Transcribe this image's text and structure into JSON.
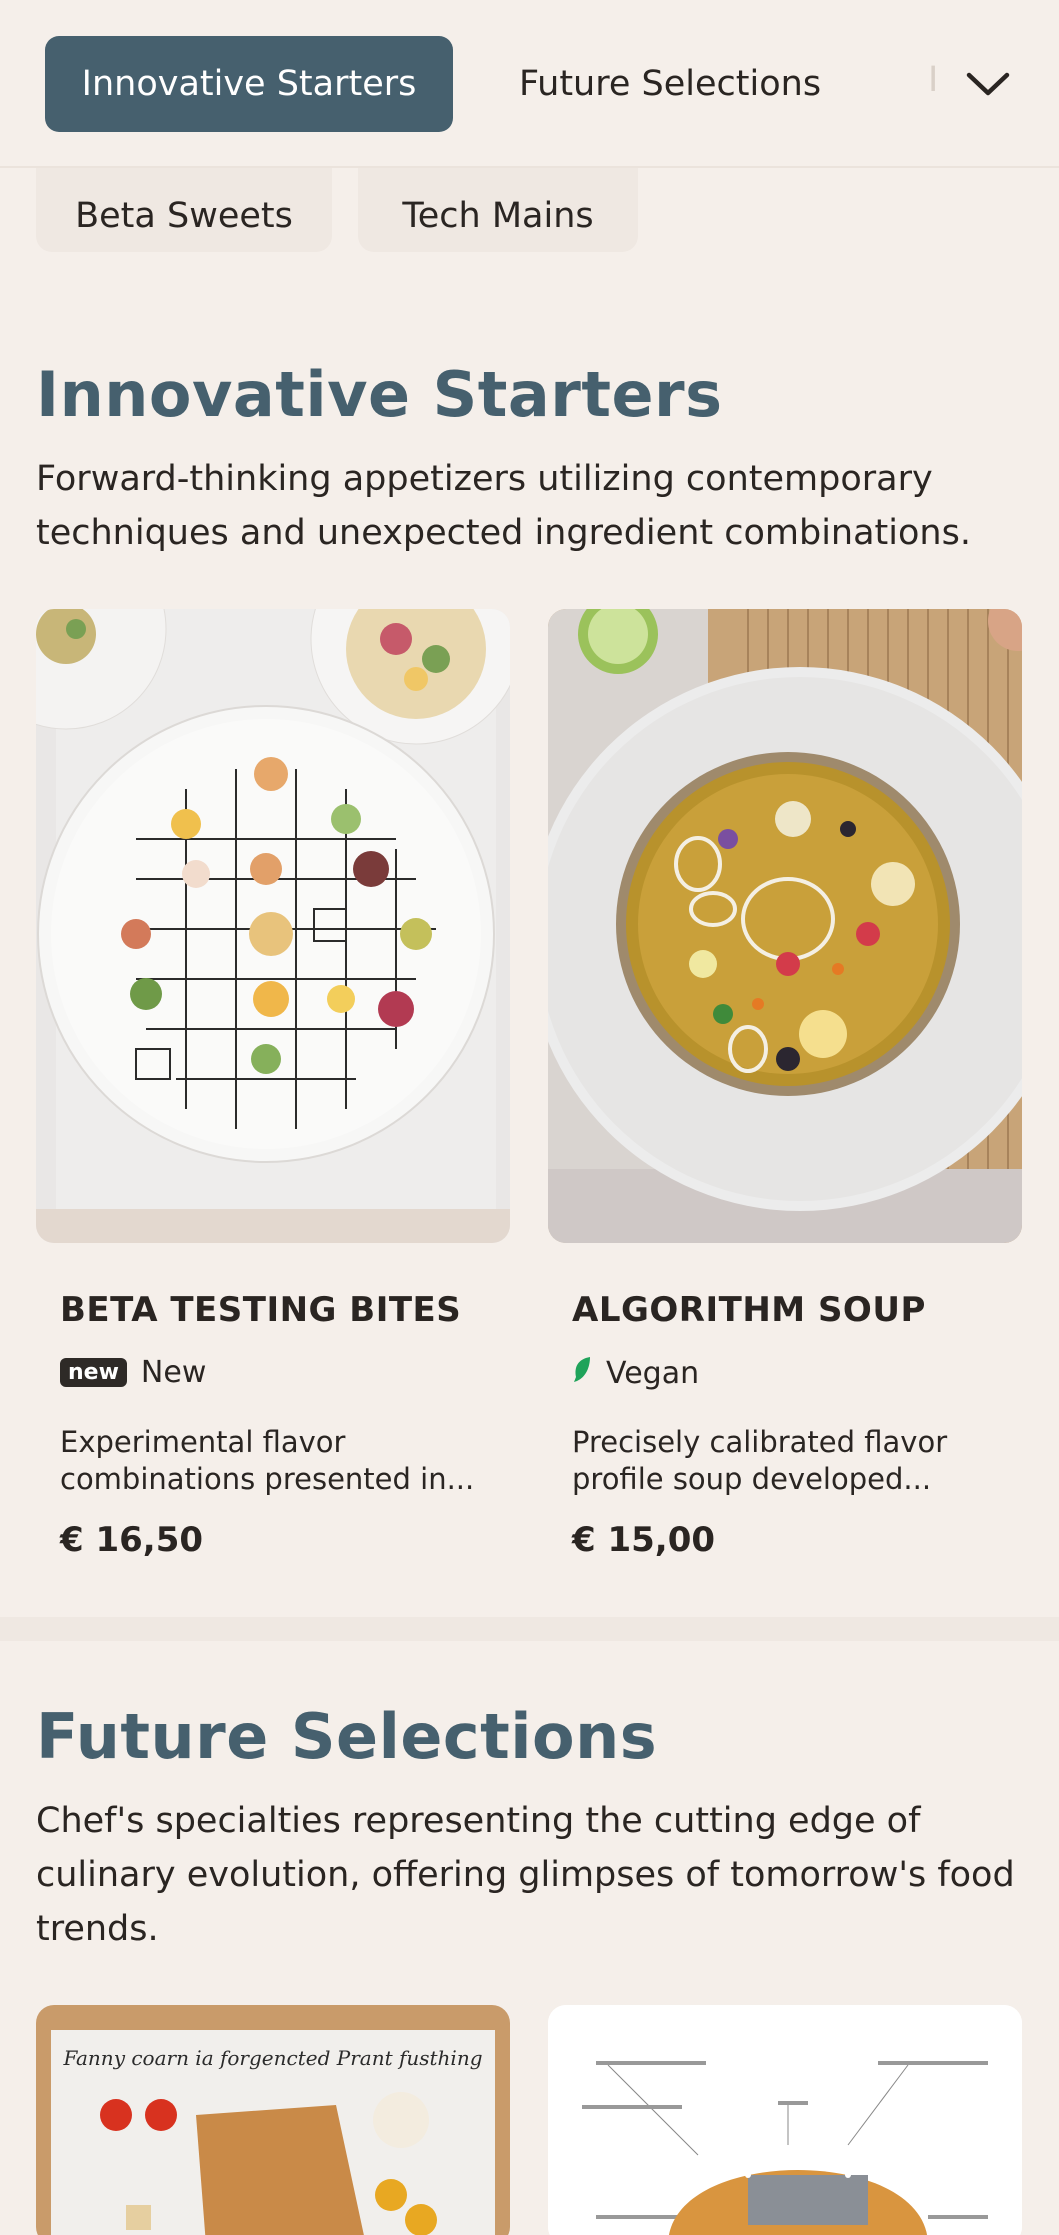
{
  "nav": {
    "tabs": [
      {
        "label": "Innovative Starters",
        "active": true
      },
      {
        "label": "Future Selections",
        "active": false
      },
      {
        "label": "I",
        "active": false
      }
    ],
    "chips": [
      "Beta Sweets",
      "Tech Mains"
    ],
    "expand_icon": "chevron-down-icon"
  },
  "sections": [
    {
      "title": "Innovative Starters",
      "description": "Forward-thinking appetizers utilizing contemporary techniques and unexpected ingredient combinations.",
      "items": [
        {
          "name": "BETA TESTING BITES",
          "tag_badge": "new",
          "tag_label": "New",
          "description": "Experimental flavor combinations presented in...",
          "price": "€ 16,50",
          "image_alt": "plate of small bites on circuit diagram"
        },
        {
          "name": "ALGORITHM SOUP",
          "tag_icon": "leaf-icon",
          "tag_label": "Vegan",
          "description": "Precisely calibrated flavor profile soup developed...",
          "price": "€ 15,00",
          "image_alt": "bowl of golden broth soup"
        }
      ]
    },
    {
      "title": "Future Selections",
      "description": "Chef's specialties representing the cutting edge of culinary evolution, offering glimpses of tomorrow's food trends.",
      "items": [
        {
          "image_caption": "Fanny coarn ia forgencted Prant fusthing"
        },
        {
          "image_alt": "burger technical diagram"
        }
      ]
    }
  ],
  "colors": {
    "background": "#f5efea",
    "accent": "#46606e",
    "text": "#2a2522",
    "vegan_green": "#1fa35a"
  }
}
